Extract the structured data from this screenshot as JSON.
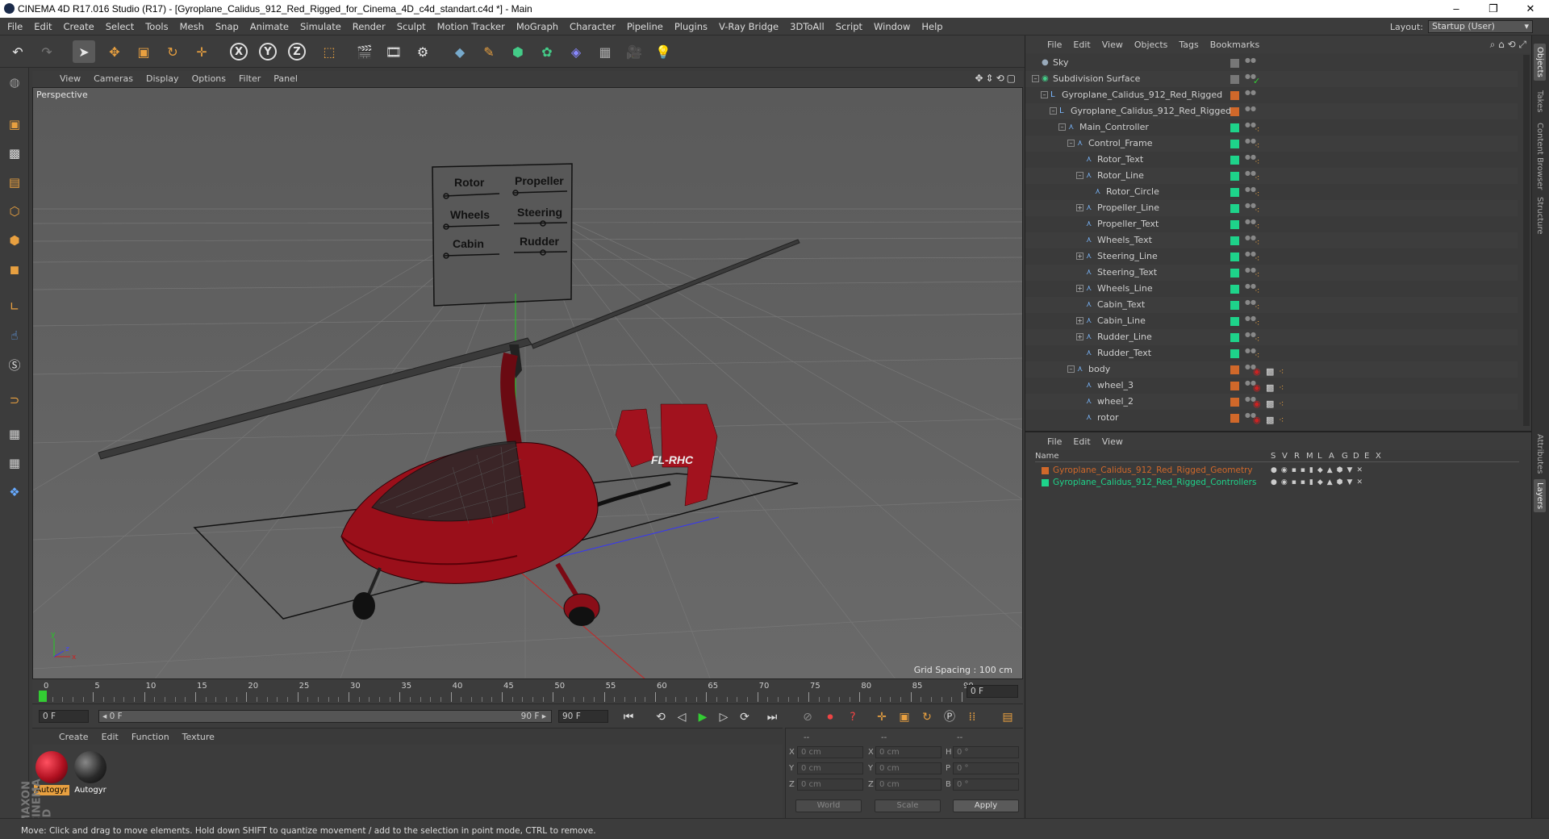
{
  "title_bar": {
    "title": "CINEMA 4D R17.016 Studio (R17) - [Gyroplane_Calidus_912_Red_Rigged_for_Cinema_4D_c4d_standart.c4d *] - Main",
    "minimize": "–",
    "maximize": "❐",
    "close": "✕"
  },
  "main_menu": [
    "File",
    "Edit",
    "Create",
    "Select",
    "Tools",
    "Mesh",
    "Snap",
    "Animate",
    "Simulate",
    "Render",
    "Sculpt",
    "Motion Tracker",
    "MoGraph",
    "Character",
    "Pipeline",
    "Plugins",
    "V-Ray Bridge",
    "3DToAll",
    "Script",
    "Window",
    "Help"
  ],
  "layout": {
    "label": "Layout:",
    "value": "Startup (User)"
  },
  "toolbar": {
    "tools": [
      "undo-icon",
      "redo-icon",
      "select-pointer-icon",
      "move-icon",
      "scale-icon",
      "rotate-icon",
      "transform-icon"
    ],
    "axes": [
      "X",
      "Y",
      "Z"
    ],
    "world": "coord-system-icon",
    "render": [
      "render-view-icon",
      "render-picture-viewer-icon",
      "render-settings-icon"
    ],
    "objects": [
      "cube-icon",
      "pen-spline-icon",
      "subdivision-icon",
      "mograph-cloner-icon",
      "deformer-icon",
      "floor-icon",
      "camera-icon",
      "light-icon"
    ]
  },
  "left_toolbar": [
    "make-editable-icon",
    "model-mode-icon",
    "texture-mode-icon",
    "workplane-icon",
    "points-mode-icon",
    "edges-mode-icon",
    "polygons-mode-icon",
    "axis-mode-icon",
    "tweak-icon",
    "snap-s-icon",
    "magnet-icon",
    "grid-lock-icon",
    "grid-snap-icon",
    "python-icon"
  ],
  "viewport": {
    "menu": [
      "View",
      "Cameras",
      "Display",
      "Options",
      "Filter",
      "Panel"
    ],
    "label": "Perspective",
    "grid_spacing": "Grid Spacing : 100 cm",
    "controller_labels": [
      "Rotor",
      "Propeller",
      "Wheels",
      "Steering",
      "Cabin",
      "Rudder"
    ],
    "tail_text": "FL-RHC"
  },
  "timeline": {
    "ticks": [
      "0",
      "5",
      "10",
      "15",
      "20",
      "25",
      "30",
      "35",
      "40",
      "45",
      "50",
      "55",
      "60",
      "65",
      "70",
      "75",
      "80",
      "85",
      "90"
    ],
    "current_frame": "0 F",
    "start_field": "0 F",
    "range_start": "◂ 0 F",
    "range_end": "90 F ▸",
    "end_field": "90 F"
  },
  "materials": {
    "menu": [
      "Create",
      "Edit",
      "Function",
      "Texture"
    ],
    "items": [
      {
        "label": "Autogyr",
        "color": "#b01020",
        "selected": true
      },
      {
        "label": "Autogyr",
        "color": "#2a2a2a",
        "selected": false
      }
    ]
  },
  "coordinates": {
    "header": [
      "--",
      "--",
      "--"
    ],
    "rows": [
      {
        "a": "X",
        "av": "0 cm",
        "b": "X",
        "bv": "0 cm",
        "c": "H",
        "cv": "0 °"
      },
      {
        "a": "Y",
        "av": "0 cm",
        "b": "Y",
        "bv": "0 cm",
        "c": "P",
        "cv": "0 °"
      },
      {
        "a": "Z",
        "av": "0 cm",
        "b": "Z",
        "bv": "0 cm",
        "c": "B",
        "cv": "0 °"
      }
    ],
    "world": "World",
    "scale": "Scale",
    "apply": "Apply"
  },
  "status_bar": "Move: Click and drag to move elements. Hold down SHIFT to quantize movement / add to the selection in point mode, CTRL to remove.",
  "object_manager": {
    "menu": [
      "File",
      "Edit",
      "View",
      "Objects",
      "Tags",
      "Bookmarks"
    ],
    "rows": [
      {
        "name": "Sky",
        "indent": 0,
        "icon": "sky-icon",
        "color": "#777",
        "expand": ""
      },
      {
        "name": "Subdivision Surface",
        "indent": 0,
        "icon": "subdivision-icon",
        "color": "#777",
        "expand": "–"
      },
      {
        "name": "Gyroplane_Calidus_912_Red_Rigged",
        "indent": 1,
        "icon": "null-icon",
        "color": "#d0682a",
        "expand": "–"
      },
      {
        "name": "Gyroplane_Calidus_912_Red_Rigged",
        "indent": 2,
        "icon": "null-icon",
        "color": "#d0682a",
        "expand": "–"
      },
      {
        "name": "Main_Controller",
        "indent": 3,
        "icon": "joint-icon",
        "color": "#1ed38a",
        "expand": "–"
      },
      {
        "name": "Control_Frame",
        "indent": 4,
        "icon": "joint-icon",
        "color": "#1ed38a",
        "expand": "–"
      },
      {
        "name": "Rotor_Text",
        "indent": 5,
        "icon": "joint-icon",
        "color": "#1ed38a",
        "expand": ""
      },
      {
        "name": "Rotor_Line",
        "indent": 5,
        "icon": "joint-icon",
        "color": "#1ed38a",
        "expand": "–"
      },
      {
        "name": "Rotor_Circle",
        "indent": 6,
        "icon": "joint-icon",
        "color": "#1ed38a",
        "expand": ""
      },
      {
        "name": "Propeller_Line",
        "indent": 5,
        "icon": "joint-icon",
        "color": "#1ed38a",
        "expand": "+"
      },
      {
        "name": "Propeller_Text",
        "indent": 5,
        "icon": "joint-icon",
        "color": "#1ed38a",
        "expand": ""
      },
      {
        "name": "Wheels_Text",
        "indent": 5,
        "icon": "joint-icon",
        "color": "#1ed38a",
        "expand": ""
      },
      {
        "name": "Steering_Line",
        "indent": 5,
        "icon": "joint-icon",
        "color": "#1ed38a",
        "expand": "+"
      },
      {
        "name": "Steering_Text",
        "indent": 5,
        "icon": "joint-icon",
        "color": "#1ed38a",
        "expand": ""
      },
      {
        "name": "Wheels_Line",
        "indent": 5,
        "icon": "joint-icon",
        "color": "#1ed38a",
        "expand": "+"
      },
      {
        "name": "Cabin_Text",
        "indent": 5,
        "icon": "joint-icon",
        "color": "#1ed38a",
        "expand": ""
      },
      {
        "name": "Cabin_Line",
        "indent": 5,
        "icon": "joint-icon",
        "color": "#1ed38a",
        "expand": "+"
      },
      {
        "name": "Rudder_Line",
        "indent": 5,
        "icon": "joint-icon",
        "color": "#1ed38a",
        "expand": "+"
      },
      {
        "name": "Rudder_Text",
        "indent": 5,
        "icon": "joint-icon",
        "color": "#1ed38a",
        "expand": ""
      },
      {
        "name": "body",
        "indent": 4,
        "icon": "joint-icon",
        "color": "#d0682a",
        "expand": "–"
      },
      {
        "name": "wheel_3",
        "indent": 5,
        "icon": "joint-icon",
        "color": "#d0682a",
        "expand": ""
      },
      {
        "name": "wheel_2",
        "indent": 5,
        "icon": "joint-icon",
        "color": "#d0682a",
        "expand": ""
      },
      {
        "name": "rotor",
        "indent": 5,
        "icon": "joint-icon",
        "color": "#d0682a",
        "expand": ""
      }
    ]
  },
  "layer_manager": {
    "menu": [
      "File",
      "Edit",
      "View"
    ],
    "columns": [
      "Name",
      "S",
      "V",
      "R",
      "M",
      "L",
      "A",
      "G",
      "D",
      "E",
      "X"
    ],
    "rows": [
      {
        "name": "Gyroplane_Calidus_912_Red_Rigged_Geometry",
        "color": "#d0682a"
      },
      {
        "name": "Gyroplane_Calidus_912_Red_Rigged_Controllers",
        "color": "#1ed38a"
      }
    ]
  },
  "side_tabs": [
    "Objects",
    "Takes",
    "Content Browser",
    "Structure",
    "Attributes",
    "Layers"
  ],
  "brand": "MAXON CINEMA 4D"
}
